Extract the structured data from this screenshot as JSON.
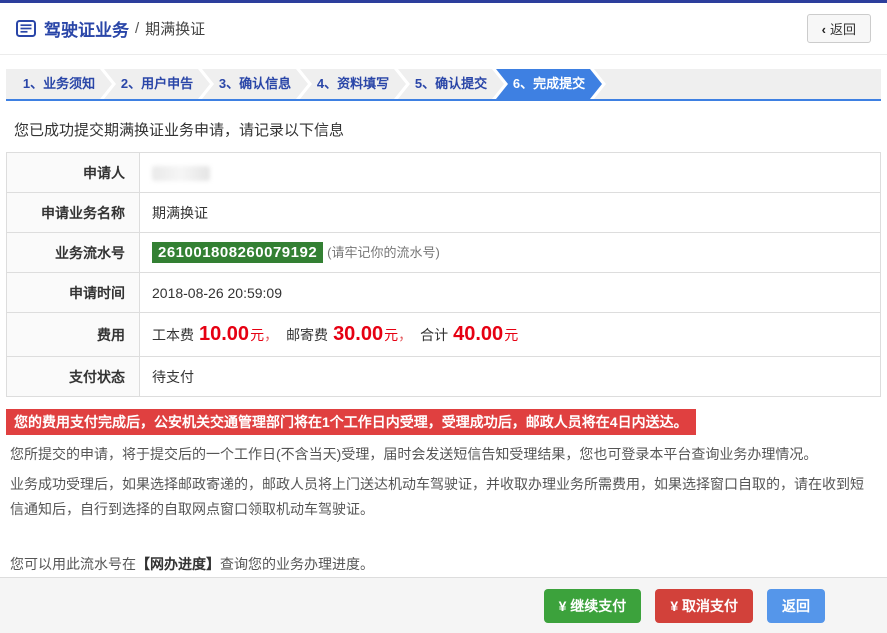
{
  "header": {
    "title": "驾驶证业务",
    "separator": "/",
    "subtitle": "期满换证",
    "back_chevron": "‹",
    "back_label": "返回"
  },
  "steps": {
    "active_index": 5,
    "items": [
      {
        "label": "1、业务须知"
      },
      {
        "label": "2、用户申告"
      },
      {
        "label": "3、确认信息"
      },
      {
        "label": "4、资料填写"
      },
      {
        "label": "5、确认提交"
      },
      {
        "label": "6、完成提交"
      }
    ]
  },
  "success_message": "您已成功提交期满换证业务申请，请记录以下信息",
  "table": {
    "rows": [
      {
        "label": "申请人",
        "value_redacted": true
      },
      {
        "label": "申请业务名称",
        "value": "期满换证"
      },
      {
        "label": "业务流水号",
        "serial": "261001808260079192",
        "note": "(请牢记你的流水号)"
      },
      {
        "label": "申请时间",
        "value": "2018-08-26 20:59:09"
      },
      {
        "label": "费用"
      },
      {
        "label": "支付状态",
        "value": "待支付"
      }
    ]
  },
  "fee": {
    "item1_label": "工本费",
    "item1_amount": "10.00",
    "item2_label": "邮寄费",
    "item2_amount": "30.00",
    "item3_label": "合计",
    "item3_amount": "40.00",
    "unit": "元",
    "sep": "，"
  },
  "notice": {
    "banner": "您的费用支付完成后，公安机关交通管理部门将在1个工作日内受理，受理成功后，邮政人员将在4日内送达。",
    "para1": "您所提交的申请，将于提交后的一个工作日(不含当天)受理，届时会发送短信告知受理结果，您也可登录本平台查询业务办理情况。",
    "para2": "业务成功受理后，如果选择邮政寄递的，邮政人员将上门送达机动车驾驶证，并收取办理业务所需费用，如果选择窗口自取的，请在收到短信通知后，自行到选择的自取网点窗口领取机动车驾驶证。",
    "para3_prefix": "您可以用此流水号在",
    "para3_link": "【网办进度】",
    "para3_suffix": "查询您的业务办理进度。"
  },
  "footer": {
    "continue_pay_label": "¥ 继续支付",
    "cancel_pay_label": "¥ 取消支付",
    "return_label": "返回"
  },
  "colors": {
    "topbar": "#2c3e9c",
    "primary_blue": "#2a46a8",
    "active_step": "#3e80e2",
    "serial_bg": "#338033",
    "fee_red": "#e60012",
    "banner_bg": "#e04040",
    "btn_green": "#3ca23c",
    "btn_red": "#d2413a",
    "btn_blue": "#5596ea"
  }
}
